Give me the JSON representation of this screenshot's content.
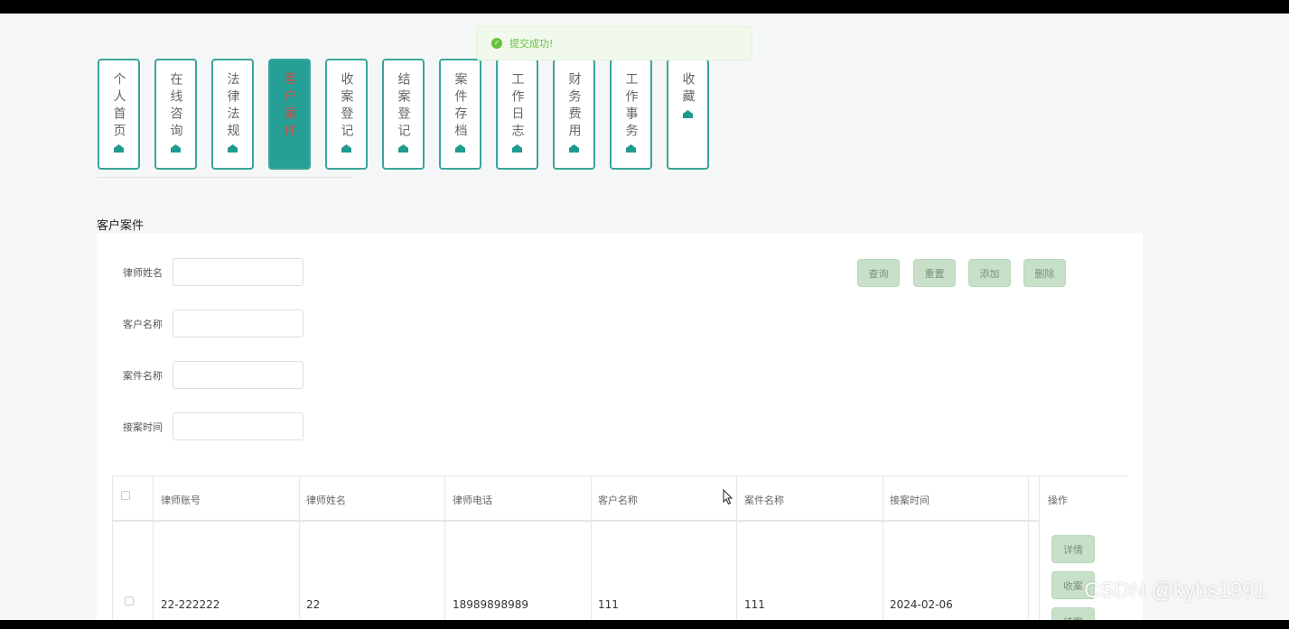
{
  "toast": {
    "message": "提交成功!"
  },
  "nav": {
    "items": [
      {
        "label": "个人首页",
        "active": false
      },
      {
        "label": "在线咨询",
        "active": false
      },
      {
        "label": "法律法规",
        "active": false
      },
      {
        "label": "客户案件",
        "active": true
      },
      {
        "label": "收案登记",
        "active": false
      },
      {
        "label": "结案登记",
        "active": false
      },
      {
        "label": "案件存档",
        "active": false
      },
      {
        "label": "工作日志",
        "active": false
      },
      {
        "label": "财务费用",
        "active": false
      },
      {
        "label": "工作事务",
        "active": false
      },
      {
        "label": "收藏",
        "active": false
      }
    ]
  },
  "page": {
    "title": "客户案件"
  },
  "search": {
    "fields": [
      {
        "label": "律师姓名",
        "value": ""
      },
      {
        "label": "客户名称",
        "value": ""
      },
      {
        "label": "案件名称",
        "value": ""
      },
      {
        "label": "接案时间",
        "value": ""
      }
    ],
    "buttons": {
      "query": "查询",
      "reset": "重置",
      "add": "添加",
      "delete": "删除"
    }
  },
  "table": {
    "columns": [
      "律师账号",
      "律师姓名",
      "律师电话",
      "客户名称",
      "案件名称",
      "接案时间",
      "操作"
    ],
    "rows": [
      {
        "cells": [
          "22-222222",
          "22",
          "18989898989",
          "111",
          "111",
          "2024-02-06"
        ],
        "actions": [
          "详情",
          "收案",
          "结案"
        ]
      }
    ]
  },
  "watermark": "CSDN @kybs1991",
  "colors": {
    "accent": "#26a096",
    "button": "#c8e0c8",
    "toast_bg": "#f0f9eb",
    "toast_text": "#67c23a"
  }
}
